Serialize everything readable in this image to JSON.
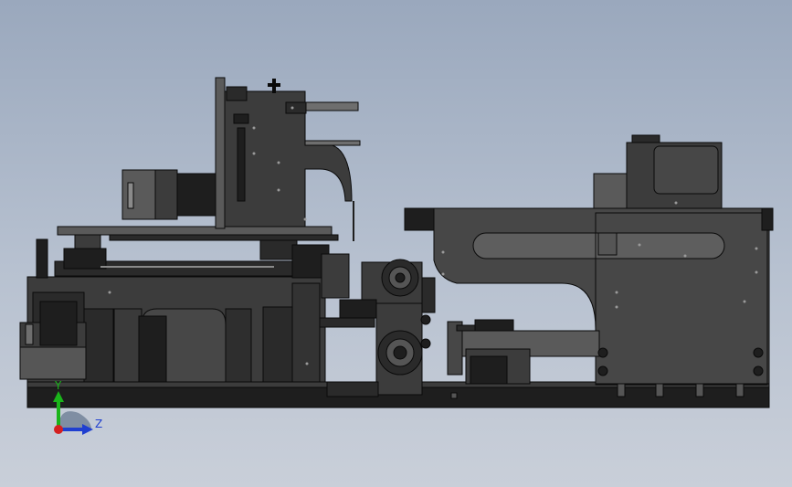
{
  "viewport": {
    "background_top": "#9aa8bd",
    "background_bottom": "#c9cfd9"
  },
  "triad": {
    "y_label": "Y",
    "z_label": "Z",
    "y_color": "#1ab41a",
    "z_color": "#1f3fd0",
    "x_color": "#d42020"
  },
  "model": {
    "body_color": "#3c3c3c",
    "dark_color": "#1e1e1e",
    "edge_color": "#0a0a0a",
    "light_color": "#6e6e6e",
    "icons": [
      "stepper-motor-icon",
      "hand-wheel-icon",
      "bearing-block-icon"
    ]
  }
}
